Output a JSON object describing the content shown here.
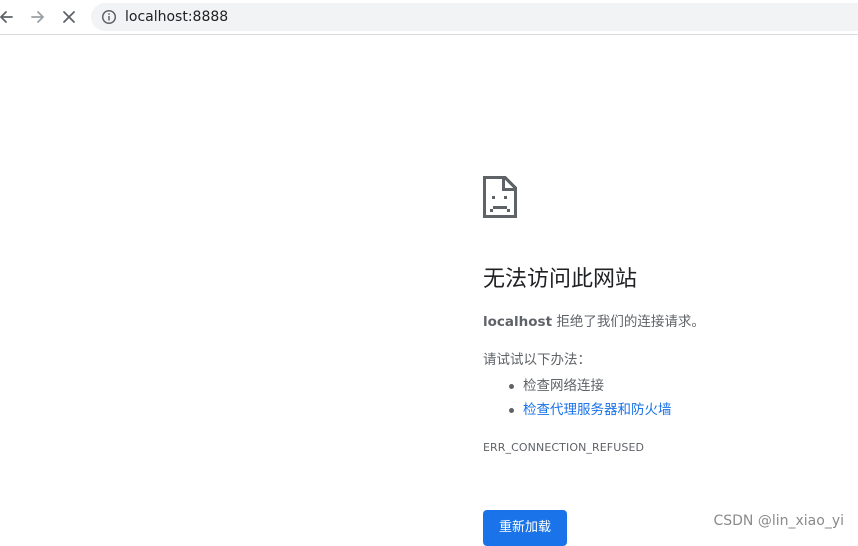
{
  "browser": {
    "back_icon": "arrow-left-icon",
    "forward_icon": "arrow-right-icon",
    "stop_icon": "close-icon",
    "info_icon": "info-icon",
    "url": "localhost:8888"
  },
  "error_page": {
    "icon": "sad-page-icon",
    "headline": "无法访问此网站",
    "host": "localhost",
    "description_suffix": " 拒绝了我们的连接请求。",
    "suggestions_title": "请试试以下办法：",
    "suggestions": [
      {
        "label": "检查网络连接",
        "link": false
      },
      {
        "label": "检查代理服务器和防火墙",
        "link": true
      }
    ],
    "error_code": "ERR_CONNECTION_REFUSED",
    "reload_label": "重新加载"
  },
  "watermark": "CSDN @lin_xiao_yi",
  "colors": {
    "accent": "#1a73e8",
    "text_primary": "#202124",
    "text_secondary": "#5f6368"
  }
}
